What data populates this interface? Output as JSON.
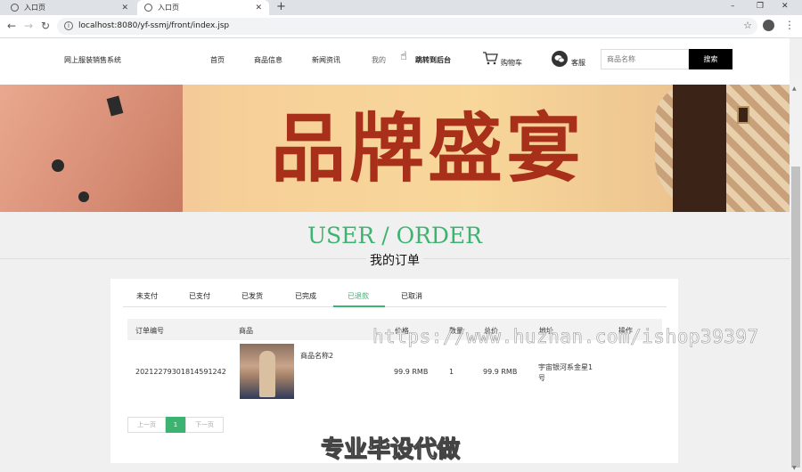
{
  "browser": {
    "tabs": [
      {
        "title": "入口页",
        "active": false
      },
      {
        "title": "入口页",
        "active": true
      }
    ],
    "new_tab": "+",
    "url": "localhost:8080/yf-ssmj/front/index.jsp",
    "window_controls": {
      "minimize": "–",
      "restore": "❐",
      "close": "✕"
    }
  },
  "header": {
    "site_name": "网上服装销售系统",
    "nav": [
      "首页",
      "商品信息",
      "新闻资讯",
      "我的",
      "跳转到后台"
    ],
    "cart_label": "购物车",
    "service_label": "客服",
    "search_placeholder": "商品名称",
    "search_button": "搜索"
  },
  "banner": {
    "text": "品牌盛宴"
  },
  "section": {
    "title_en": "USER / ORDER",
    "title_cn": "我的订单"
  },
  "order_tabs": {
    "items": [
      "未支付",
      "已支付",
      "已发货",
      "已完成",
      "已退款",
      "已取消"
    ],
    "active_index": 4
  },
  "table": {
    "columns": [
      "订单编号",
      "商品",
      "价格",
      "数量",
      "总价",
      "地址",
      "操作"
    ],
    "rows": [
      {
        "order_no": "20212279301814591242",
        "product_name": "商品名称2",
        "price": "99.9 RMB",
        "quantity": "1",
        "total": "99.9 RMB",
        "address_line1": "宇宙银河系金星1",
        "address_line2": "号",
        "action": ""
      }
    ]
  },
  "pagination": {
    "prev": "上一页",
    "current": "1",
    "next": "下一页"
  },
  "watermarks": {
    "url": "https://www.huzhan.com/ishop39397",
    "caption": "专业毕设代做"
  },
  "colors": {
    "accent": "#3cb371",
    "banner_text": "#a8301a",
    "search_button": "#000000"
  }
}
